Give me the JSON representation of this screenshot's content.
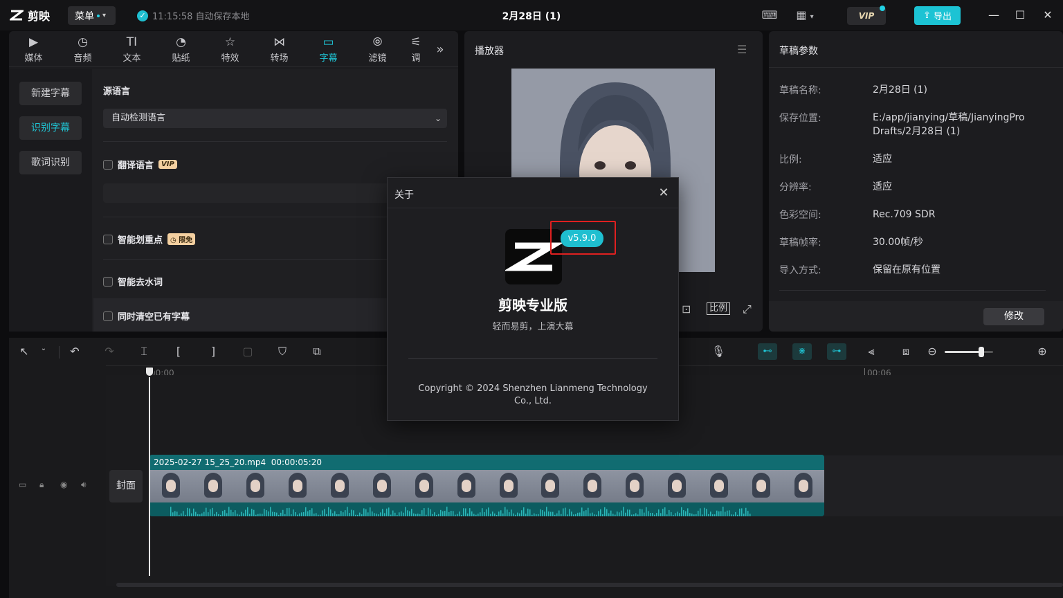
{
  "titlebar": {
    "app_name": "剪映",
    "menu_label": "菜单",
    "autosave": "11:15:58 自动保存本地",
    "project_title": "2月28日 (1)",
    "vip_label": "VIP",
    "export_label": "导出"
  },
  "tabs": [
    {
      "label": "媒体",
      "icon": "media-icon"
    },
    {
      "label": "音频",
      "icon": "audio-icon"
    },
    {
      "label": "文本",
      "icon": "text-icon"
    },
    {
      "label": "贴纸",
      "icon": "sticker-icon"
    },
    {
      "label": "特效",
      "icon": "effects-icon"
    },
    {
      "label": "转场",
      "icon": "transition-icon"
    },
    {
      "label": "字幕",
      "icon": "subtitle-icon",
      "active": true
    },
    {
      "label": "滤镜",
      "icon": "filter-icon"
    },
    {
      "label": "调",
      "icon": "adjust-icon"
    }
  ],
  "subtitle_nav": {
    "new": "新建字幕",
    "recognize": "识别字幕",
    "lyrics": "歌词识别"
  },
  "subtitle_settings": {
    "source_language_label": "源语言",
    "source_language_value": "自动检测语言",
    "translate_label": "翻译语言",
    "translate_badge": "VIP",
    "highlight_label": "智能划重点",
    "highlight_badge": "限免",
    "remove_filler_label": "智能去水词",
    "clear_existing_label": "同时清空已有字幕"
  },
  "player": {
    "title": "播放器",
    "ratio_label": "比例"
  },
  "draft": {
    "title": "草稿参数",
    "fields": [
      {
        "key": "草稿名称:",
        "value": "2月28日 (1)"
      },
      {
        "key": "保存位置:",
        "value": "E:/app/jianying/草稿/JianyingPro Drafts/2月28日 (1)"
      },
      {
        "key": "比例:",
        "value": "适应"
      },
      {
        "key": "分辨率:",
        "value": "适应"
      },
      {
        "key": "色彩空间:",
        "value": "Rec.709 SDR"
      },
      {
        "key": "草稿帧率:",
        "value": "30.00帧/秒"
      },
      {
        "key": "导入方式:",
        "value": "保留在原有位置"
      }
    ],
    "modify_label": "修改"
  },
  "timeline": {
    "ruler_start": "00:00",
    "ruler_mark": "00:06",
    "cover_label": "封面",
    "clip_name": "2025-02-27 15_25_20.mp4",
    "clip_duration": "00:00:05:20",
    "zoom_level": 0.75
  },
  "about_dialog": {
    "title": "关于",
    "version": "v5.9.0",
    "app_name": "剪映专业版",
    "slogan": "轻而易剪，上演大幕",
    "copyright": "Copyright © 2024 Shenzhen Lianmeng Technology Co., Ltd."
  },
  "colors": {
    "accent": "#1fc6d6",
    "highlight_box": "#e02020"
  }
}
